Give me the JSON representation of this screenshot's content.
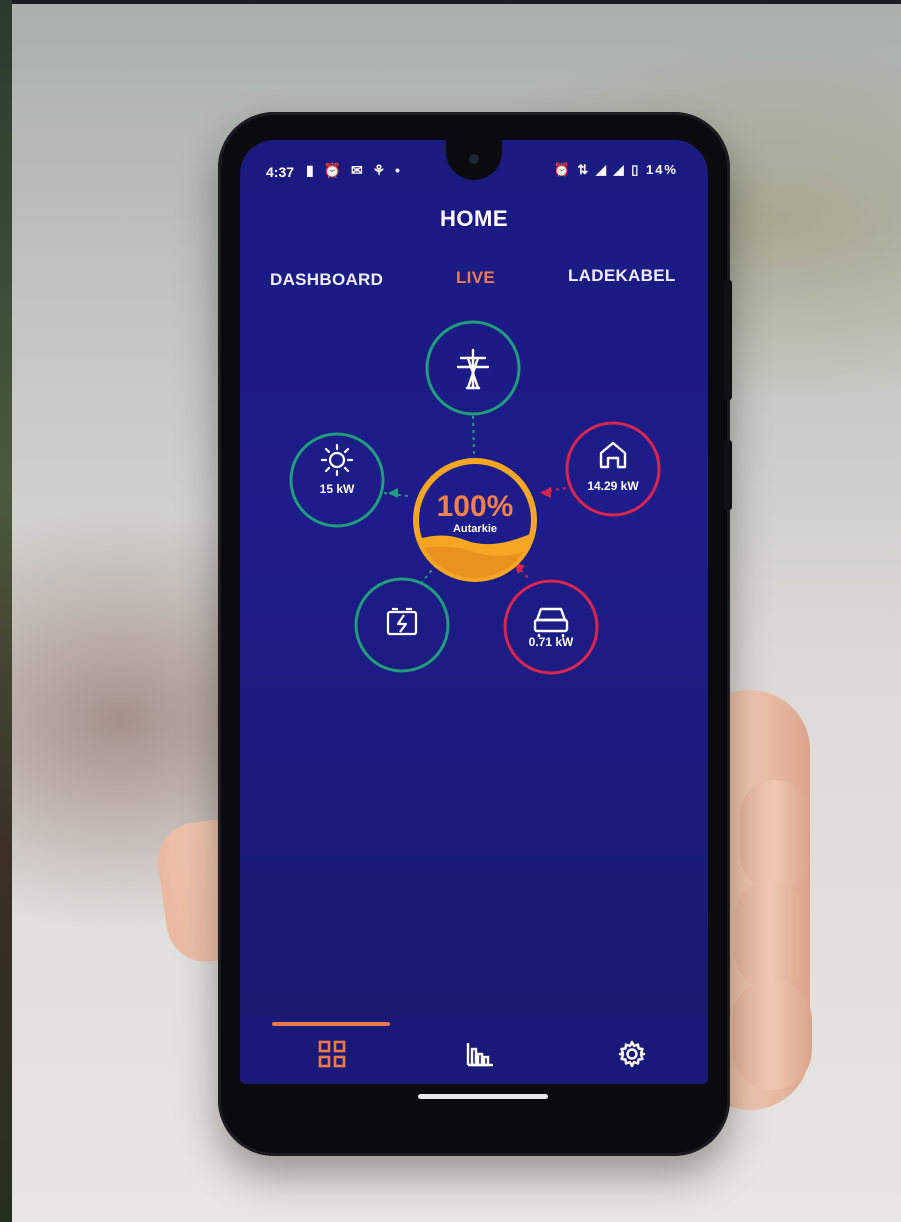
{
  "status_bar": {
    "time": "4:37",
    "battery": "14%"
  },
  "app": {
    "title": "HOME"
  },
  "tabs": [
    {
      "label": "DASHBOARD",
      "active": false
    },
    {
      "label": "LIVE",
      "active": true
    },
    {
      "label": "LADEKABEL",
      "active": false
    }
  ],
  "live": {
    "center": {
      "value": "100%",
      "label": "Autarkie"
    },
    "nodes": {
      "grid": {
        "icon": "power-tower-icon",
        "value": ""
      },
      "solar": {
        "icon": "sun-icon",
        "value": "15 kW"
      },
      "house": {
        "icon": "house-icon",
        "value": "14.29 kW"
      },
      "battery": {
        "icon": "battery-icon",
        "value": ""
      },
      "car": {
        "icon": "car-icon",
        "value": "0.71 kW"
      }
    }
  },
  "bottom_nav": [
    {
      "icon": "dashboard-grid-icon",
      "active": true
    },
    {
      "icon": "bar-chart-icon",
      "active": false
    },
    {
      "icon": "gear-icon",
      "active": false
    }
  ],
  "colors": {
    "screen_bg": "#1c1b86",
    "accent_orange": "#ee7a45",
    "center_yellow": "#f6a623",
    "node_green": "#1f9d7c",
    "node_red": "#d9264f"
  }
}
